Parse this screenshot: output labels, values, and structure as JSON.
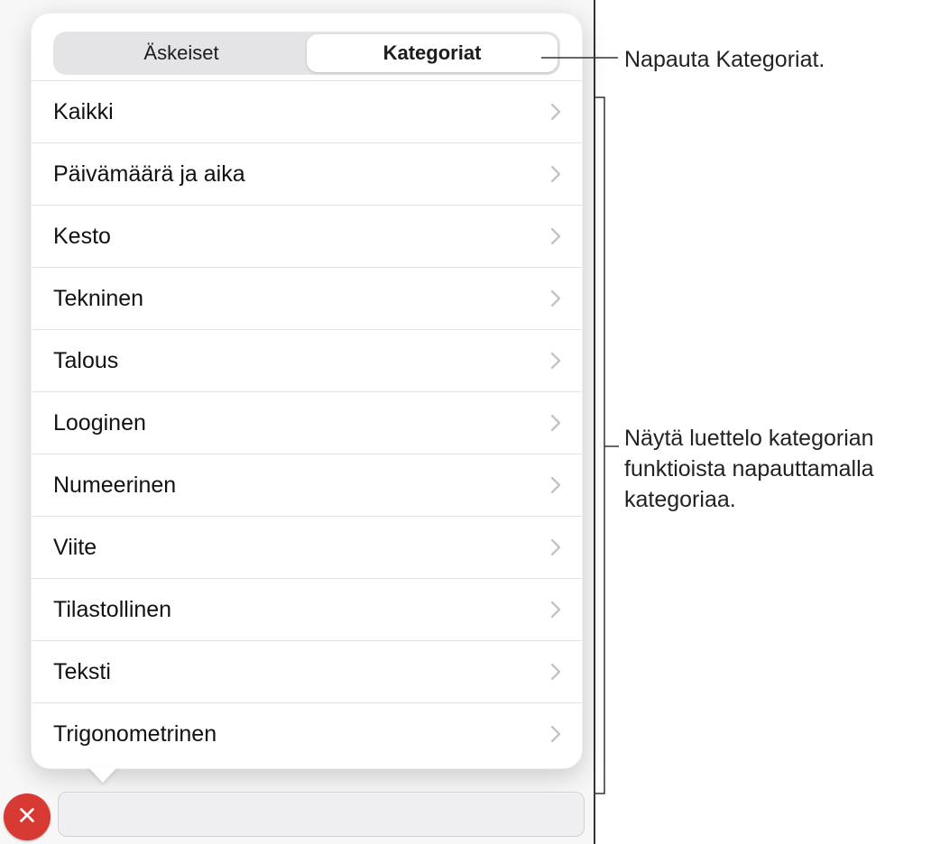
{
  "segmented": {
    "recent_label": "Äskeiset",
    "categories_label": "Kategoriat",
    "active": "categories"
  },
  "categories": [
    {
      "label": "Kaikki"
    },
    {
      "label": "Päivämäärä ja aika"
    },
    {
      "label": "Kesto"
    },
    {
      "label": "Tekninen"
    },
    {
      "label": "Talous"
    },
    {
      "label": "Looginen"
    },
    {
      "label": "Numeerinen"
    },
    {
      "label": "Viite"
    },
    {
      "label": "Tilastollinen"
    },
    {
      "label": "Teksti"
    },
    {
      "label": "Trigonometrinen"
    }
  ],
  "callouts": {
    "tap_categories": "Napauta Kategoriat.",
    "tap_category_detail": "Näytä luettelo kategorian funktioista napauttamalla kategoriaa."
  }
}
